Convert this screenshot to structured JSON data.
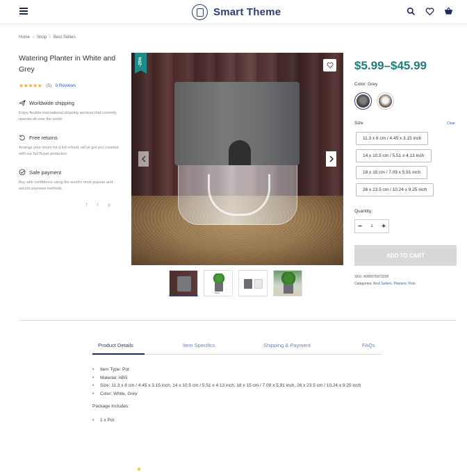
{
  "header": {
    "brand": "Smart Theme",
    "menu_icon": "hamburger-icon",
    "icons": [
      "search-icon",
      "heart-icon",
      "cart-icon"
    ]
  },
  "breadcrumb": [
    "Home",
    "Shop",
    "Best Sellers"
  ],
  "product": {
    "title": "Watering Planter in White and Grey",
    "rating_count": "(5)",
    "reviews_link": "9 Reviews",
    "stars": "★★★★★",
    "price": "$5.99–$45.99",
    "discount": "-25%",
    "color_label": "Color: Grey",
    "colors": [
      "Grey",
      "White"
    ],
    "size_label": "Size",
    "clear": "Clear",
    "sizes": [
      "11.3 x 8 cm / 4.45 x 3.15 inch",
      "14 x 10.5 cm / 5.51 x 4.13 inch",
      "18 x 15 cm / 7.09 x 5.91 inch",
      "26 x 23.5 cm / 10.24 x 9.25 inch"
    ],
    "quantity_label": "Quantity:",
    "quantity_value": "1",
    "add_to_cart": "ADD TO CART",
    "sku": "SKU: 4000975973328",
    "categories_label": "Categories:",
    "categories": [
      "Best Sellers",
      "Planters",
      "Pots"
    ]
  },
  "features": [
    {
      "icon": "plane-icon",
      "title": "Worldwide shipping",
      "desc": "Enjoy flexible international shipping services that currently operate all over the world"
    },
    {
      "icon": "return-icon",
      "title": "Free returns",
      "desc": "Arrange your return for a full refund, we've got you covered with our full Buyer protection"
    },
    {
      "icon": "check-circle-icon",
      "title": "Safe payment",
      "desc": "Buy with confidence using the world's most popular and secure payment methods"
    }
  ],
  "social": [
    "f",
    "t",
    "p"
  ],
  "tabs": [
    "Product Details",
    "Item Specifics",
    "Shipping & Payment",
    "FAQs"
  ],
  "details": {
    "items": [
      "Item Type: Pot",
      "Material: ABS",
      "Size: 11.3 x 8 cm / 4.45 x 3.15 inch, 14 x 10.5 cm / 5.51 x 4.13 inch, 18 x 15 cm / 7.09 x 5.91 inch, 26 x 23.5 cm / 10.24 x 9.25 inch",
      "Color: White, Grey"
    ],
    "package_heading": "Package Includes:",
    "package_items": [
      "1 x Pot"
    ]
  },
  "thumbnail_caption": "Yellow",
  "colors": {
    "accent": "#1d7e78",
    "brand": "#2b3c7a",
    "link": "#2f63b8",
    "star": "#f4a732"
  }
}
